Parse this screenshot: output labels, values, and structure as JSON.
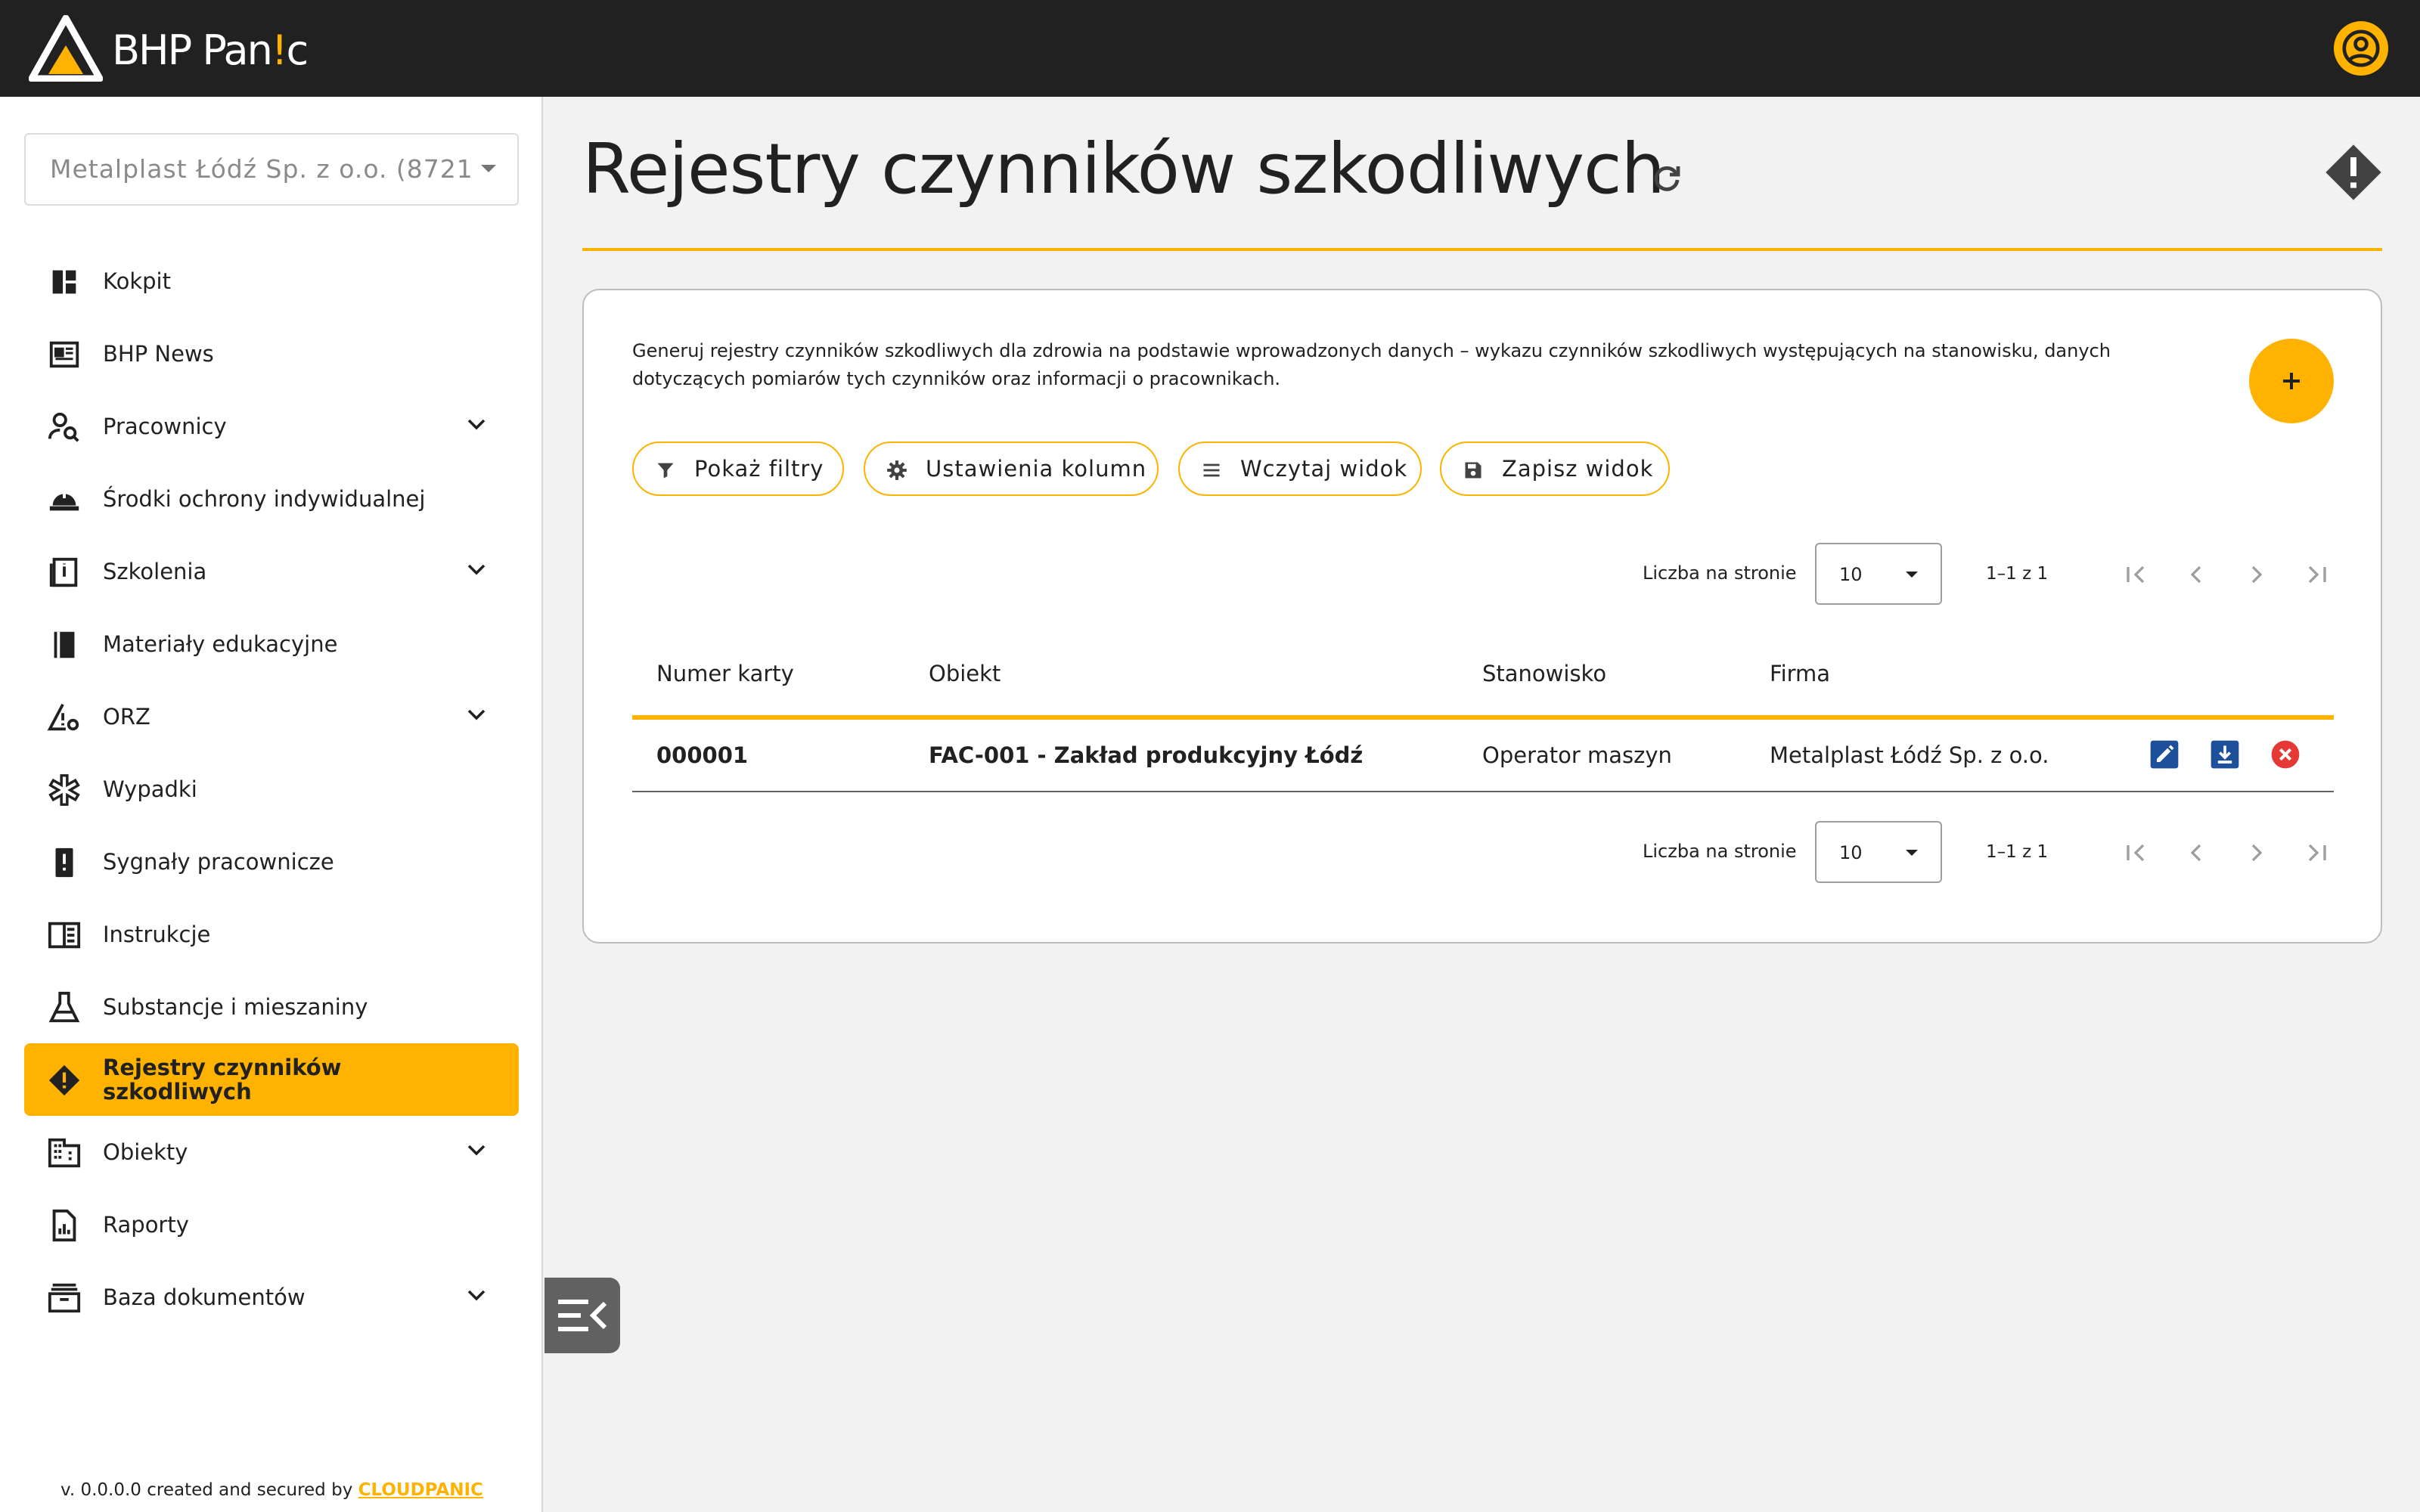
{
  "app": {
    "brand_prefix": "BHP Pan",
    "brand_accent": "!",
    "brand_suffix": "c",
    "colors": {
      "accent": "#ffb300",
      "topbar": "#212121",
      "action_blue": "#1e4f99",
      "delete_red": "#e53935"
    }
  },
  "sidebar": {
    "company_value": "Metalplast Łódź Sp. z o.o. (8721...",
    "items": [
      {
        "label": "Kokpit",
        "icon": "dashboard-icon",
        "expandable": false,
        "active": false
      },
      {
        "label": "BHP News",
        "icon": "newspaper-icon",
        "expandable": false,
        "active": false
      },
      {
        "label": "Pracownicy",
        "icon": "person-search-icon",
        "expandable": true,
        "active": false
      },
      {
        "label": "Środki ochrony indywidualnej",
        "icon": "hard-hat-icon",
        "expandable": false,
        "active": false
      },
      {
        "label": "Szkolenia",
        "icon": "training-book-icon",
        "expandable": true,
        "active": false
      },
      {
        "label": "Materiały edukacyjne",
        "icon": "book-icon",
        "expandable": false,
        "active": false
      },
      {
        "label": "ORZ",
        "icon": "risk-warning-icon",
        "expandable": true,
        "active": false
      },
      {
        "label": "Wypadki",
        "icon": "medical-star-icon",
        "expandable": false,
        "active": false
      },
      {
        "label": "Sygnały pracownicze",
        "icon": "signal-report-icon",
        "expandable": false,
        "active": false
      },
      {
        "label": "Instrukcje",
        "icon": "instructions-icon",
        "expandable": false,
        "active": false
      },
      {
        "label": "Substancje i mieszaniny",
        "icon": "flask-icon",
        "expandable": false,
        "active": false
      },
      {
        "label": "Rejestry czynników szkodliwych",
        "icon": "warning-diamond-icon",
        "expandable": false,
        "active": true
      },
      {
        "label": "Obiekty",
        "icon": "building-icon",
        "expandable": true,
        "active": false
      },
      {
        "label": "Raporty",
        "icon": "report-icon",
        "expandable": false,
        "active": false
      },
      {
        "label": "Baza dokumentów",
        "icon": "archive-icon",
        "expandable": true,
        "active": false
      }
    ],
    "version_text": "v. 0.0.0.0 created and secured by ",
    "version_brand": "CLOUDPANIC"
  },
  "main": {
    "title": "Rejestry czynników szkodliwych",
    "description": "Generuj rejestry czynników szkodliwych dla zdrowia na podstawie wprowadzonych danych – wykazu czynników szkodliwych występujących na stanowisku, danych dotyczących pomiarów tych czynników oraz informacji o pracownikach.",
    "toolbar": {
      "show_filters": "Pokaż filtry",
      "column_settings": "Ustawienia kolumn",
      "load_view": "Wczytaj widok",
      "save_view": "Zapisz widok"
    },
    "pagination": {
      "per_page_label": "Liczba na stronie",
      "per_page_value": "10",
      "range": "1–1 z 1"
    },
    "table": {
      "columns": [
        "Numer karty",
        "Obiekt",
        "Stanowisko",
        "Firma"
      ],
      "rows": [
        {
          "card_no": "000001",
          "object": "FAC-001 - Zakład produkcyjny Łódź",
          "position": "Operator maszyn",
          "company": "Metalplast Łódź Sp. z o.o."
        }
      ]
    }
  }
}
